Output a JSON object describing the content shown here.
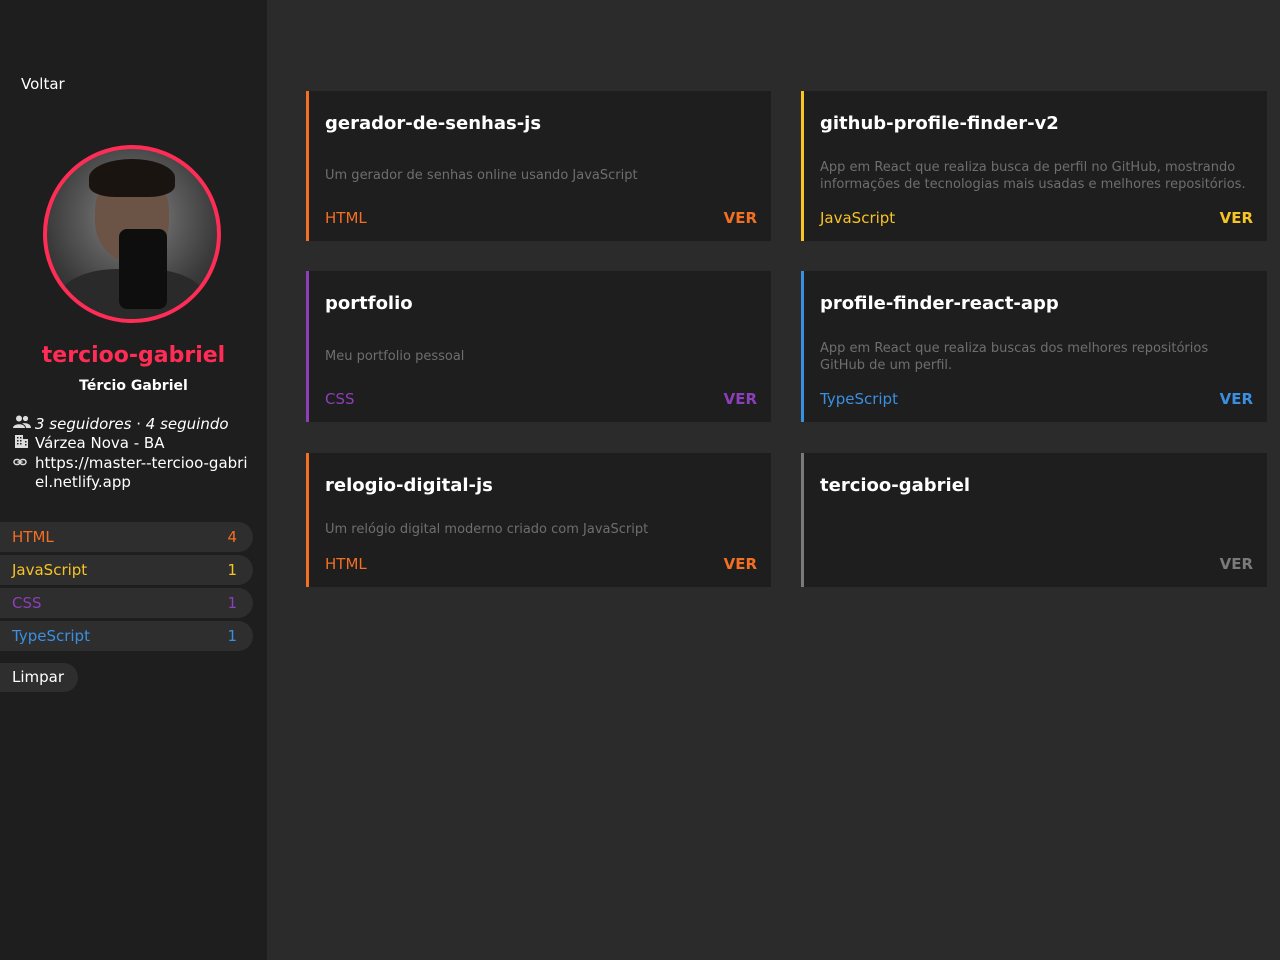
{
  "colors": {
    "HTML": "#f36f22",
    "JavaScript": "#f7c325",
    "CSS": "#8c3fb8",
    "TypeScript": "#3b8fe0",
    "none": "#7a7a7a",
    "accent": "#ff2d55"
  },
  "sidebar": {
    "back_label": "Voltar",
    "username": "tercioo-gabriel",
    "full_name": "Tércio Gabriel",
    "followers": "3 seguidores",
    "separator": " · ",
    "following": "4 seguindo",
    "location": "Várzea Nova - BA",
    "website": "https://master--tercioo-gabriel.netlify.app",
    "languages": [
      {
        "name": "HTML",
        "count": "4"
      },
      {
        "name": "JavaScript",
        "count": "1"
      },
      {
        "name": "CSS",
        "count": "1"
      },
      {
        "name": "TypeScript",
        "count": "1"
      }
    ],
    "clear_label": "Limpar"
  },
  "repos": [
    {
      "title": "gerador-de-senhas-js",
      "description": "Um gerador de senhas online usando JavaScript",
      "language": "HTML",
      "ver_label": "VER"
    },
    {
      "title": "github-profile-finder-v2",
      "description": "App em React que realiza busca de perfil no GitHub, mostrando informações de tecnologias mais usadas e melhores repositórios.",
      "language": "JavaScript",
      "ver_label": "VER"
    },
    {
      "title": "portfolio",
      "description": "Meu portfolio pessoal",
      "language": "CSS",
      "ver_label": "VER"
    },
    {
      "title": "profile-finder-react-app",
      "description": "App em React que realiza buscas dos melhores repositórios GitHub de um perfil.",
      "language": "TypeScript",
      "ver_label": "VER"
    },
    {
      "title": "relogio-digital-js",
      "description": "Um relógio digital moderno criado com JavaScript",
      "language": "HTML",
      "ver_label": "VER"
    },
    {
      "title": "tercioo-gabriel",
      "description": "",
      "language": "",
      "ver_label": "VER"
    }
  ]
}
